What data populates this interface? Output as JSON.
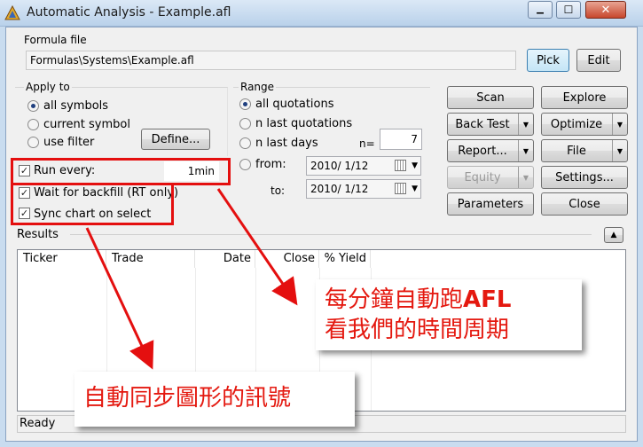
{
  "window": {
    "title": "Automatic Analysis - Example.afl",
    "minimize_glyph": "▁",
    "maximize_glyph": "☐",
    "close_glyph": "✕"
  },
  "formula": {
    "label": "Formula file",
    "path": "Formulas\\Systems\\Example.afl",
    "pick_label": "Pick",
    "edit_label": "Edit"
  },
  "apply_to": {
    "label": "Apply to",
    "options": [
      "all symbols",
      "current symbol",
      "use filter"
    ],
    "selected": "all symbols",
    "define_label": "Define..."
  },
  "options": {
    "run_every_label": "Run every:",
    "run_every_value": "1min",
    "wait_backfill_label": "Wait for backfill (RT only)",
    "sync_chart_label": "Sync chart on select",
    "run_every_checked": true,
    "wait_backfill_checked": true,
    "sync_chart_checked": true
  },
  "range": {
    "label": "Range",
    "options": [
      "all quotations",
      "n last quotations",
      "n last days",
      "from:"
    ],
    "selected": "all quotations",
    "n_label": "n=",
    "n_value": "7",
    "to_label": "to:",
    "from_date": "2010/  1/12",
    "to_date": "2010/  1/12"
  },
  "buttons": {
    "scan": "Scan",
    "explore": "Explore",
    "backtest": "Back Test",
    "optimize": "Optimize",
    "report": "Report...",
    "file": "File",
    "equity": "Equity",
    "settings": "Settings...",
    "parameters": "Parameters",
    "close": "Close"
  },
  "results": {
    "label": "Results",
    "collapse_glyph": "▲",
    "columns": [
      "Ticker",
      "Trade",
      "Date",
      "Close",
      "% Yield"
    ]
  },
  "status": {
    "text": "Ready"
  },
  "annotations": {
    "run_every_note_line1_cjk": "每分鐘自動跑",
    "run_every_note_line1_latin": "AFL",
    "run_every_note_line2": "看我們的時間周期",
    "sync_note": "自動同步圖形的訊號"
  },
  "colors": {
    "annotation_red": "#e40f0f",
    "title_bar": "#c9dcef",
    "dialog_bg": "#f0f0f0"
  }
}
